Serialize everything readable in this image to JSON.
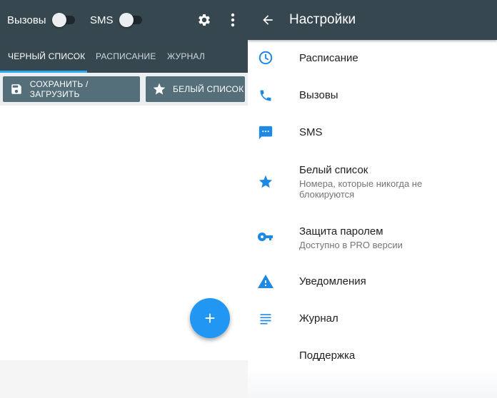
{
  "left": {
    "toolbar": {
      "calls_label": "Вызовы",
      "sms_label": "SMS"
    },
    "tabs": [
      {
        "label": "ЧЕРНЫЙ СПИСОК",
        "active": true
      },
      {
        "label": "РАСПИСАНИЕ",
        "active": false
      },
      {
        "label": "ЖУРНАЛ",
        "active": false
      }
    ],
    "actions": {
      "save_load_label": "СОХРАНИТЬ / ЗАГРУЗИТЬ",
      "whitelist_label": "БЕЛЫЙ СПИСОК"
    },
    "fab_label": "+"
  },
  "right": {
    "title": "Настройки",
    "items": [
      {
        "icon": "clock-icon",
        "title": "Расписание",
        "subtitle": ""
      },
      {
        "icon": "phone-icon",
        "title": "Вызовы",
        "subtitle": ""
      },
      {
        "icon": "message-icon",
        "title": "SMS",
        "subtitle": ""
      },
      {
        "icon": "star-icon",
        "title": "Белый список",
        "subtitle": "Номера, которые никогда не блокируются"
      },
      {
        "icon": "key-icon",
        "title": "Защита паролем",
        "subtitle": "Доступно в PRO версии"
      },
      {
        "icon": "warning-icon",
        "title": "Уведомления",
        "subtitle": ""
      },
      {
        "icon": "list-icon",
        "title": "Журнал",
        "subtitle": ""
      },
      {
        "icon": "",
        "title": "Поддержка",
        "subtitle": ""
      }
    ]
  },
  "colors": {
    "toolbar": "#37474f",
    "accent": "#2196f3",
    "tab_indicator": "#29a8f2",
    "action_button": "#546e7a",
    "icon_blue": "#1e88e5"
  }
}
